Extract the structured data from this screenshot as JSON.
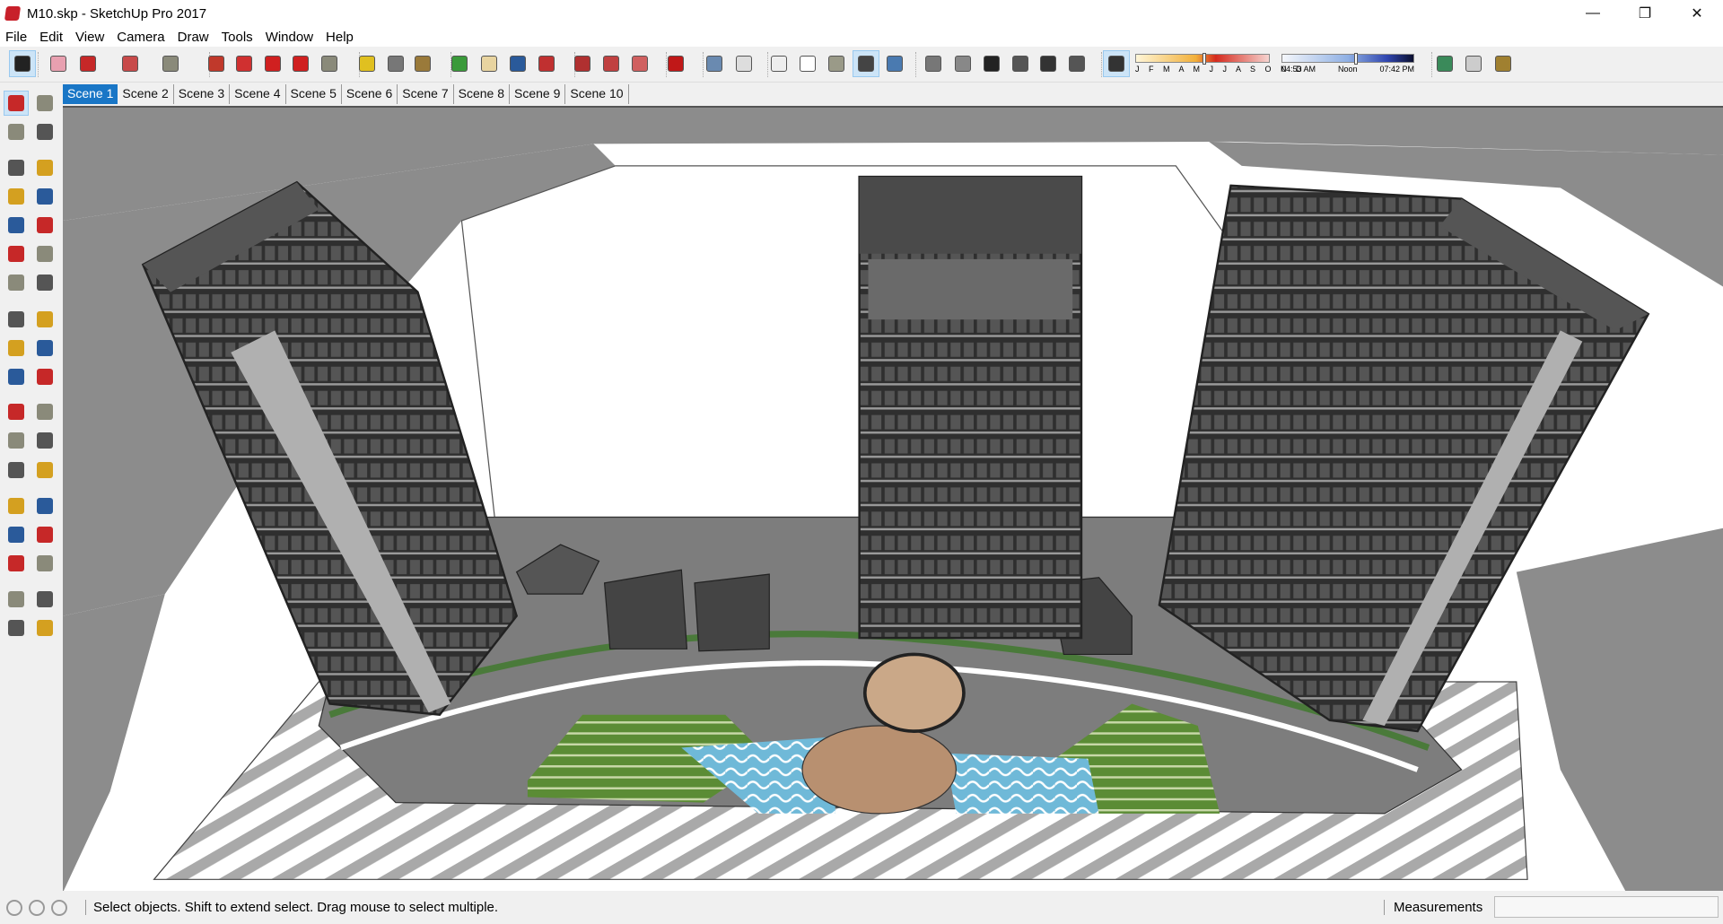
{
  "window": {
    "title": "M10.skp - SketchUp Pro 2017",
    "controls": [
      "—",
      "❐",
      "✕"
    ]
  },
  "menu": [
    "File",
    "Edit",
    "View",
    "Camera",
    "Draw",
    "Tools",
    "Window",
    "Help"
  ],
  "toolbar": {
    "buttons": [
      {
        "name": "select-icon",
        "color": "#222",
        "active": true
      },
      {
        "name": "eraser-icon",
        "color": "#e8a0b0"
      },
      {
        "name": "pencil-icon",
        "color": "#c62828"
      },
      {
        "name": "arc-icon",
        "color": "#c84a4a"
      },
      {
        "name": "rectangle-icon",
        "color": "#8a8a7a"
      },
      {
        "name": "push-pull-icon",
        "color": "#c0392b"
      },
      {
        "name": "follow-me-icon",
        "color": "#d03030"
      },
      {
        "name": "move-icon",
        "color": "#d02020"
      },
      {
        "name": "rotate-icon",
        "color": "#d02020"
      },
      {
        "name": "scale-icon",
        "color": "#8a8a7a"
      },
      {
        "name": "tape-measure-icon",
        "color": "#e0c020"
      },
      {
        "name": "text-icon",
        "color": "#777"
      },
      {
        "name": "paint-bucket-icon",
        "color": "#9a7a3a"
      },
      {
        "name": "orbit-icon",
        "color": "#3a9a3a"
      },
      {
        "name": "pan-icon",
        "color": "#e8d4a0"
      },
      {
        "name": "zoom-icon",
        "color": "#2a5a9a"
      },
      {
        "name": "zoom-extents-icon",
        "color": "#c03030"
      },
      {
        "name": "3d-warehouse-icon",
        "color": "#b03030"
      },
      {
        "name": "extension-warehouse-icon",
        "color": "#c04040"
      },
      {
        "name": "send-to-layout-icon",
        "color": "#d06060"
      },
      {
        "name": "extension-manager-icon",
        "color": "#c01818"
      },
      {
        "name": "xray-icon",
        "color": "#6a8ab0"
      },
      {
        "name": "back-edges-icon",
        "color": "#ddd"
      },
      {
        "name": "wireframe-icon",
        "color": "#eee"
      },
      {
        "name": "hidden-line-icon",
        "color": "#fff"
      },
      {
        "name": "shaded-icon",
        "color": "#9a9a88"
      },
      {
        "name": "shaded-textures-icon",
        "color": "#444",
        "active": true
      },
      {
        "name": "monochrome-icon",
        "color": "#4a7ab0"
      },
      {
        "name": "iso-view-icon",
        "color": "#777"
      },
      {
        "name": "top-view-icon",
        "color": "#888"
      },
      {
        "name": "front-view-icon",
        "color": "#222"
      },
      {
        "name": "right-view-icon",
        "color": "#555"
      },
      {
        "name": "back-view-icon",
        "color": "#333"
      },
      {
        "name": "left-view-icon",
        "color": "#555"
      },
      {
        "name": "shadows-toggle-icon",
        "color": "#333",
        "active": true
      },
      {
        "name": "add-location-icon",
        "color": "#3a8a5a"
      },
      {
        "name": "toggle-terrain-icon",
        "color": "#ccc"
      },
      {
        "name": "photo-textures-icon",
        "color": "#a08030"
      }
    ],
    "shadow_months": "J F M A M J J A S O N D",
    "time_labels": [
      "04:53 AM",
      "Noon",
      "07:42 PM"
    ],
    "shadow_date_fraction": 0.5,
    "time_fraction": 0.55
  },
  "scenes": [
    "Scene 1",
    "Scene 2",
    "Scene 3",
    "Scene 4",
    "Scene 5",
    "Scene 6",
    "Scene 7",
    "Scene 8",
    "Scene 9",
    "Scene 10"
  ],
  "left_tools": [
    [
      "select-icon",
      "component-icon"
    ],
    [
      "paint-bucket-icon",
      "eraser-icon"
    ],
    [
      "line-icon",
      "freehand-icon"
    ],
    [
      "rectangle-icon",
      "rotated-rectangle-icon"
    ],
    [
      "circle-icon",
      "polygon-icon"
    ],
    [
      "arc-icon",
      "two-point-arc-icon"
    ],
    [
      "three-point-arc-icon",
      "pie-icon"
    ],
    [
      "move-icon",
      "push-pull-icon"
    ],
    [
      "rotate-icon",
      "follow-me-icon"
    ],
    [
      "scale-icon",
      "offset-icon"
    ],
    [
      "tape-measure-icon",
      "dimension-icon"
    ],
    [
      "protractor-icon",
      "text-icon"
    ],
    [
      "axes-icon",
      "3d-text-icon"
    ],
    [
      "orbit-icon",
      "pan-icon"
    ],
    [
      "zoom-icon",
      "zoom-window-icon"
    ],
    [
      "zoom-extents-icon",
      "previous-view-icon"
    ],
    [
      "position-camera-icon",
      "look-around-icon"
    ],
    [
      "walk-icon",
      "section-plane-icon"
    ]
  ],
  "status": {
    "text": "Select objects. Shift to extend select. Drag mouse to select multiple.",
    "measurements_label": "Measurements",
    "measurements_value": ""
  },
  "colors": {
    "accent": "#1976c6",
    "road": "#8c8c8c",
    "building": "#3b3b3b",
    "grass": "#5b8c35",
    "water": "#6fb9d8"
  }
}
